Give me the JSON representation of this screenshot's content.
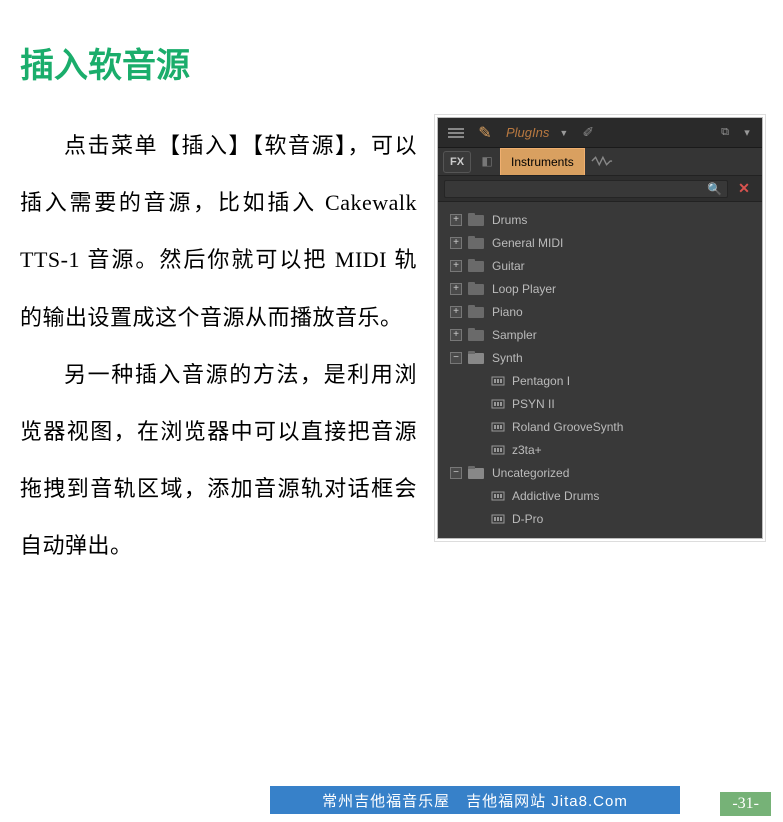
{
  "page": {
    "title": "插入软音源",
    "paragraph1": "点击菜单【插入】【软音源】，可以插入需要的音源，比如插入 Cakewalk TTS-1 音源。然后你就可以把 MIDI 轨的输出设置成这个音源从而播放音乐。",
    "paragraph2": "另一种插入音源的方法，是利用浏览器视图，在浏览器中可以直接把音源拖拽到音轨区域，添加音源轨对话框会自动弹出。"
  },
  "screenshot": {
    "titlebar": {
      "label": "PlugIns"
    },
    "tabs": {
      "fx": "FX",
      "active": "Instruments"
    },
    "tree": [
      {
        "type": "folder",
        "level": 0,
        "expanded": false,
        "label": "Drums"
      },
      {
        "type": "folder",
        "level": 0,
        "expanded": false,
        "label": "General MIDI"
      },
      {
        "type": "folder",
        "level": 0,
        "expanded": false,
        "label": "Guitar"
      },
      {
        "type": "folder",
        "level": 0,
        "expanded": false,
        "label": "Loop Player"
      },
      {
        "type": "folder",
        "level": 0,
        "expanded": false,
        "label": "Piano"
      },
      {
        "type": "folder",
        "level": 0,
        "expanded": false,
        "label": "Sampler"
      },
      {
        "type": "folder",
        "level": 0,
        "expanded": true,
        "label": "Synth"
      },
      {
        "type": "plugin",
        "level": 1,
        "label": "Pentagon I"
      },
      {
        "type": "plugin",
        "level": 1,
        "label": "PSYN II"
      },
      {
        "type": "plugin",
        "level": 1,
        "label": "Roland GrooveSynth"
      },
      {
        "type": "plugin",
        "level": 1,
        "label": "z3ta+"
      },
      {
        "type": "folder",
        "level": 0,
        "expanded": true,
        "label": "Uncategorized"
      },
      {
        "type": "plugin",
        "level": 1,
        "label": "Addictive Drums"
      },
      {
        "type": "plugin",
        "level": 1,
        "label": "D-Pro"
      }
    ]
  },
  "footer": {
    "text": "常州吉他福音乐屋　吉他福网站 Jita8.Com",
    "page_number": "-31-"
  }
}
